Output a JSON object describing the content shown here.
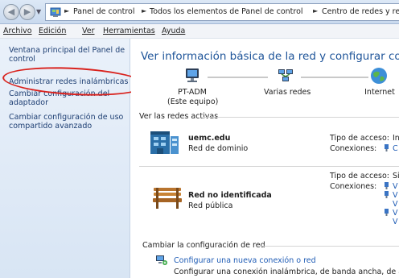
{
  "address_bar": {
    "breadcrumb": [
      "Panel de control",
      "Todos los elementos de Panel de control",
      "Centro de redes y recursos comparti"
    ]
  },
  "menu": {
    "items": [
      "Archivo",
      "Edición",
      "Ver",
      "Herramientas",
      "Ayuda"
    ]
  },
  "sidebar": {
    "items": [
      "Ventana principal del Panel de control",
      "Administrar redes inalámbricas",
      "Cambiar configuración del adaptador",
      "Cambiar configuración de uso compartido avanzado"
    ],
    "highlight_color": "#d9221d"
  },
  "main": {
    "title": "Ver información básica de la red y configurar conexiones",
    "map": {
      "computer": "PT-ADM",
      "computer_sub": "(Este equipo)",
      "middle": "Varias redes",
      "internet": "Internet"
    },
    "active_section": "Ver las redes activas",
    "networks": [
      {
        "name": "uemc.edu",
        "type": "Red de dominio",
        "access_label": "Tipo de acceso:",
        "access_value": "In",
        "connections_label": "Conexiones:",
        "connections": [
          "C"
        ]
      },
      {
        "name": "Red no identificada",
        "type": "Red pública",
        "access_label": "Tipo de acceso:",
        "access_value": "Si",
        "connections_label": "Conexiones:",
        "connections": [
          "V",
          "V",
          "V",
          "V",
          "V"
        ]
      }
    ],
    "change_section": "Cambiar la configuración de red",
    "task": {
      "link": "Configurar una nueva conexión o red",
      "desc": "Configurar una conexión inalámbrica, de banda ancha, de acceso telefo"
    }
  },
  "colors": {
    "link": "#1f5cb5",
    "title": "#1e5499",
    "sidebar_link": "#1e3f73"
  }
}
